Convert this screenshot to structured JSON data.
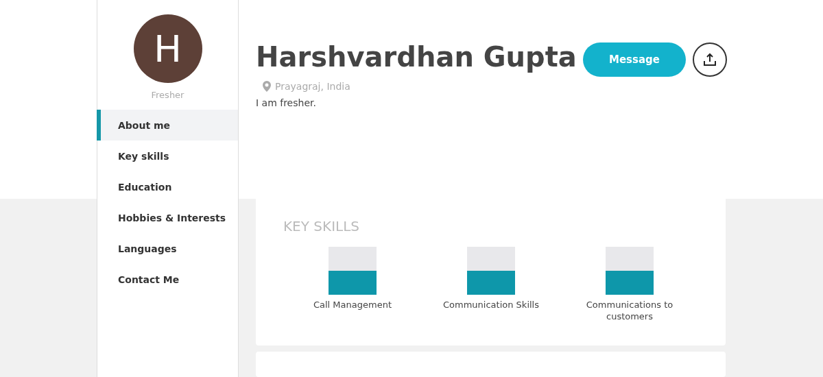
{
  "profile": {
    "initial": "H",
    "status": "Fresher",
    "name": "Harshvardhan Gupta",
    "location": "Prayagraj, India",
    "about": "I am fresher.",
    "message_button": "Message"
  },
  "sidebar": {
    "items": [
      {
        "label": "About me",
        "selected": true
      },
      {
        "label": "Key skills",
        "selected": false
      },
      {
        "label": "Education",
        "selected": false
      },
      {
        "label": "Hobbies & Interests",
        "selected": false
      },
      {
        "label": "Languages",
        "selected": false
      },
      {
        "label": "Contact Me",
        "selected": false
      }
    ]
  },
  "key_skills": {
    "title": "KEY SKILLS",
    "skills": [
      {
        "name": "Call Management"
      },
      {
        "name": "Communication Skills"
      },
      {
        "name": "Communications to customers"
      }
    ]
  }
}
